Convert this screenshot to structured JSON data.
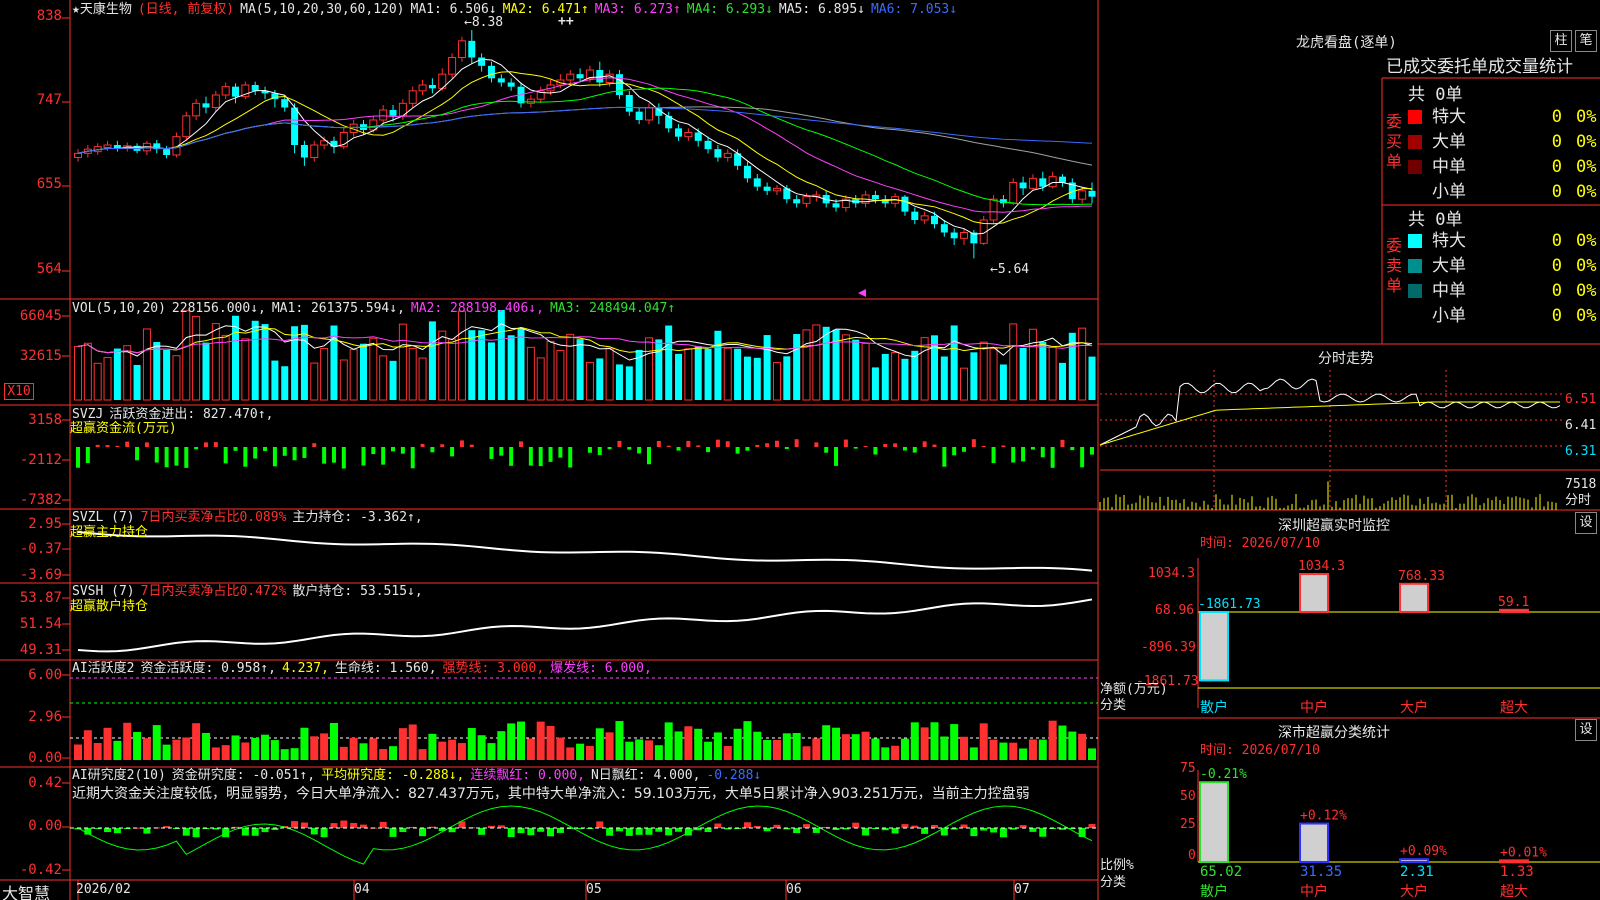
{
  "header": {
    "title": "★天康生物",
    "mode": "(日线, 前复权)",
    "ma_params": "MA(5,10,20,30,60,120)",
    "ma1": "MA1: 6.506↓",
    "ma2": "MA2: 6.471↑",
    "ma3": "MA3: 6.273↑",
    "ma4": "MA4: 6.293↓",
    "ma5": "MA5: 6.895↓",
    "ma6": "MA6: 7.053↓"
  },
  "price_axis": [
    "838",
    "747",
    "655",
    "564"
  ],
  "annotations": {
    "high": "8.38",
    "low": "5.64",
    "marker": "++"
  },
  "vol_header": {
    "label": "VOL(5,10,20)",
    "v": "228156.000↓,",
    "ma1": "MA1: 261375.594↓,",
    "ma2": "MA2: 288198.406↓,",
    "ma3": "MA3: 248494.047↑"
  },
  "vol_axis": [
    "66045",
    "32615",
    "X10"
  ],
  "svzj_header": {
    "name": "SVZJ",
    "text": "活跃资金进出: 827.470↑,",
    "sub": "超赢资金流(万元)"
  },
  "svzj_axis": [
    "3158",
    "-2112",
    "-7382"
  ],
  "svzl_header": {
    "name": "SVZL (7)",
    "text1": "7日内买卖净占比0.089%",
    "text2": "主力持仓: -3.362↑,",
    "sub": "超赢主力持仓"
  },
  "svzl_axis": [
    "2.95",
    "-0.37",
    "-3.69"
  ],
  "svsh_header": {
    "name": "SVSH (7)",
    "text1": "7日内买卖净占比0.472%",
    "text2": "散户持仓: 53.515↓,",
    "sub": "超赢散户持仓"
  },
  "svsh_axis": [
    "53.87",
    "51.54",
    "49.31"
  ],
  "ai1_header": {
    "name": "AI活跃度2",
    "t1": "资金活跃度: 0.958↑,",
    "t2": "4.237,",
    "t3": "生命线: 1.560,",
    "t4": "强势线: 3.000,",
    "t5": "爆发线: 6.000,"
  },
  "ai1_axis": [
    "6.00",
    "2.96",
    "0.00"
  ],
  "ai2_header": {
    "name": "AI研究度2(10)",
    "t1": "资金研究度: -0.051↑,",
    "t2": "平均研究度: -0.288↓,",
    "t3": "连续飘红: 0.000,",
    "t4": "N日飘红: 4.000,",
    "t5": "-0.288↓"
  },
  "ai2_text": "近期大资金关注度较低，明显弱势，今日大单净流入：827.437万元，其中特大单净流入：59.103万元，大单5日累计净入903.251万元，当前主力控盘弱",
  "ai2_axis": [
    "0.42",
    "0.00",
    "-0.42"
  ],
  "date_axis": [
    "2026/02",
    "04",
    "05",
    "06",
    "07"
  ],
  "logo": "大智慧",
  "right_panel": {
    "title": "龙虎看盘(逐单)",
    "btn1": "柱",
    "btn2": "笔",
    "table_head": "已成交委托单成交量统计",
    "buy_label": "委买单",
    "sell_label": "委卖单",
    "buy_total": "共 0单",
    "sell_total": "共 0单",
    "buy_rows": [
      {
        "label": "特大",
        "count": "0",
        "pct": "0%",
        "color": "#ff0000"
      },
      {
        "label": "大单",
        "count": "0",
        "pct": "0%",
        "color": "#a00000"
      },
      {
        "label": "中单",
        "count": "0",
        "pct": "0%",
        "color": "#700000"
      },
      {
        "label": "小单",
        "count": "0",
        "pct": "0%",
        "color": "#000000"
      }
    ],
    "sell_rows": [
      {
        "label": "特大",
        "count": "0",
        "pct": "0%",
        "color": "#00ffff"
      },
      {
        "label": "大单",
        "count": "0",
        "pct": "0%",
        "color": "#008f8f"
      },
      {
        "label": "中单",
        "count": "0",
        "pct": "0%",
        "color": "#006a6a"
      },
      {
        "label": "小单",
        "count": "0",
        "pct": "0%",
        "color": "#000000"
      }
    ],
    "intraday_title": "分时走势",
    "intraday_axis": [
      "6.51",
      "6.41",
      "6.31"
    ],
    "intraday_vol": [
      "7518",
      "分时"
    ],
    "sz_monitor_title": "深圳超赢实时监控",
    "sz_monitor_btn": "设",
    "sz_time": "时间: 2026/07/10",
    "sz_axis": [
      "1034.3",
      "68.96",
      "-896.39",
      "-1861.73"
    ],
    "sz_axis_label": [
      "净额(万元)",
      "分类"
    ],
    "sz_bars": [
      {
        "cat": "散户",
        "value": -1861.73,
        "label": "-1861.73"
      },
      {
        "cat": "中户",
        "value": 1034.3,
        "label": "1034.3"
      },
      {
        "cat": "大户",
        "value": 768.33,
        "label": "768.33"
      },
      {
        "cat": "超大",
        "value": 59.1,
        "label": "59.1"
      }
    ],
    "sz_class_title": "深市超赢分类统计",
    "sz_class_btn": "设",
    "sz_class_time": "时间: 2026/07/10",
    "sz_class_axis": [
      "75",
      "50",
      "25",
      "0"
    ],
    "sz_class_axis_label": [
      "比例%",
      "分类"
    ],
    "sz_class_bars": [
      {
        "cat": "散户",
        "value": 65.02,
        "label": "65.02",
        "chg": "-0.21%"
      },
      {
        "cat": "中户",
        "value": 31.35,
        "label": "31.35",
        "chg": "+0.12%"
      },
      {
        "cat": "大户",
        "value": 2.31,
        "label": "2.31",
        "chg": "+0.09%"
      },
      {
        "cat": "超大",
        "value": 1.33,
        "label": "1.33",
        "chg": "+0.01%"
      }
    ]
  },
  "chart_data": {
    "type": "candlestick",
    "price_range": [
      5.5,
      8.5
    ],
    "candles": [
      [
        6.85,
        6.9,
        6.8,
        6.95
      ],
      [
        6.9,
        6.95,
        6.85,
        7.0
      ],
      [
        6.92,
        6.98,
        6.88,
        7.02
      ],
      [
        6.97,
        7.0,
        6.93,
        7.05
      ],
      [
        7.0,
        6.96,
        6.92,
        7.05
      ],
      [
        6.96,
        6.99,
        6.92,
        7.03
      ],
      [
        6.99,
        6.93,
        6.9,
        7.02
      ],
      [
        6.93,
        7.02,
        6.88,
        7.05
      ],
      [
        7.02,
        6.95,
        6.9,
        7.06
      ],
      [
        6.95,
        6.88,
        6.84,
        6.99
      ],
      [
        6.88,
        7.1,
        6.85,
        7.15
      ],
      [
        7.1,
        7.35,
        7.05,
        7.4
      ],
      [
        7.35,
        7.5,
        7.3,
        7.55
      ],
      [
        7.5,
        7.45,
        7.38,
        7.58
      ],
      [
        7.45,
        7.6,
        7.4,
        7.65
      ],
      [
        7.6,
        7.7,
        7.55,
        7.75
      ],
      [
        7.7,
        7.58,
        7.5,
        7.74
      ],
      [
        7.58,
        7.72,
        7.55,
        7.76
      ],
      [
        7.72,
        7.65,
        7.6,
        7.76
      ],
      [
        7.65,
        7.62,
        7.55,
        7.7
      ],
      [
        7.62,
        7.55,
        7.45,
        7.66
      ],
      [
        7.55,
        7.45,
        7.4,
        7.6
      ],
      [
        7.45,
        7.0,
        6.9,
        7.5
      ],
      [
        7.0,
        6.85,
        6.75,
        7.05
      ],
      [
        6.85,
        7.0,
        6.8,
        7.05
      ],
      [
        7.0,
        7.05,
        6.95,
        7.1
      ],
      [
        7.05,
        6.98,
        6.9,
        7.1
      ],
      [
        6.98,
        7.15,
        6.95,
        7.2
      ],
      [
        7.15,
        7.25,
        7.1,
        7.3
      ],
      [
        7.25,
        7.18,
        7.12,
        7.3
      ],
      [
        7.18,
        7.3,
        7.15,
        7.35
      ],
      [
        7.3,
        7.42,
        7.25,
        7.48
      ],
      [
        7.42,
        7.35,
        7.28,
        7.48
      ],
      [
        7.35,
        7.5,
        7.3,
        7.55
      ],
      [
        7.5,
        7.65,
        7.45,
        7.7
      ],
      [
        7.65,
        7.72,
        7.6,
        7.78
      ],
      [
        7.72,
        7.68,
        7.62,
        7.8
      ],
      [
        7.68,
        7.85,
        7.65,
        7.92
      ],
      [
        7.85,
        8.05,
        7.8,
        8.1
      ],
      [
        8.05,
        8.25,
        8.0,
        8.3
      ],
      [
        8.25,
        8.05,
        7.98,
        8.38
      ],
      [
        8.05,
        7.95,
        7.88,
        8.1
      ],
      [
        7.95,
        7.8,
        7.75,
        8.0
      ],
      [
        7.8,
        7.75,
        7.7,
        7.85
      ],
      [
        7.75,
        7.7,
        7.65,
        7.8
      ],
      [
        7.7,
        7.5,
        7.45,
        7.75
      ],
      [
        7.5,
        7.55,
        7.45,
        7.6
      ],
      [
        7.55,
        7.65,
        7.5,
        7.7
      ],
      [
        7.65,
        7.72,
        7.6,
        7.78
      ],
      [
        7.72,
        7.78,
        7.68,
        7.85
      ],
      [
        7.78,
        7.85,
        7.72,
        7.9
      ],
      [
        7.85,
        7.8,
        7.75,
        7.92
      ],
      [
        7.8,
        7.9,
        7.75,
        7.95
      ],
      [
        7.9,
        7.75,
        7.7,
        8.0
      ],
      [
        7.75,
        7.85,
        7.7,
        7.9
      ],
      [
        7.85,
        7.6,
        7.55,
        7.9
      ],
      [
        7.6,
        7.4,
        7.35,
        7.65
      ],
      [
        7.4,
        7.3,
        7.25,
        7.45
      ],
      [
        7.3,
        7.45,
        7.25,
        7.5
      ],
      [
        7.45,
        7.35,
        7.25,
        7.5
      ],
      [
        7.35,
        7.2,
        7.15,
        7.4
      ],
      [
        7.2,
        7.1,
        7.05,
        7.25
      ],
      [
        7.1,
        7.15,
        7.05,
        7.2
      ],
      [
        7.15,
        7.05,
        6.98,
        7.2
      ],
      [
        7.05,
        6.95,
        6.9,
        7.1
      ],
      [
        6.95,
        6.85,
        6.8,
        7.0
      ],
      [
        6.85,
        6.9,
        6.8,
        6.95
      ],
      [
        6.9,
        6.75,
        6.7,
        6.95
      ],
      [
        6.75,
        6.6,
        6.55,
        6.8
      ],
      [
        6.6,
        6.5,
        6.45,
        6.65
      ],
      [
        6.5,
        6.45,
        6.4,
        6.55
      ],
      [
        6.45,
        6.48,
        6.4,
        6.52
      ],
      [
        6.48,
        6.35,
        6.3,
        6.52
      ],
      [
        6.35,
        6.3,
        6.25,
        6.4
      ],
      [
        6.3,
        6.38,
        6.25,
        6.42
      ],
      [
        6.38,
        6.4,
        6.32,
        6.45
      ],
      [
        6.4,
        6.3,
        6.25,
        6.45
      ],
      [
        6.3,
        6.25,
        6.2,
        6.35
      ],
      [
        6.25,
        6.35,
        6.2,
        6.4
      ],
      [
        6.35,
        6.3,
        6.25,
        6.4
      ],
      [
        6.3,
        6.4,
        6.25,
        6.45
      ],
      [
        6.4,
        6.35,
        6.3,
        6.45
      ],
      [
        6.35,
        6.3,
        6.25,
        6.4
      ],
      [
        6.3,
        6.38,
        6.25,
        6.42
      ],
      [
        6.38,
        6.2,
        6.15,
        6.4
      ],
      [
        6.2,
        6.1,
        6.05,
        6.25
      ],
      [
        6.1,
        6.15,
        6.05,
        6.2
      ],
      [
        6.15,
        6.05,
        6.0,
        6.2
      ],
      [
        6.05,
        5.95,
        5.9,
        6.1
      ],
      [
        5.95,
        5.88,
        5.8,
        6.0
      ],
      [
        5.88,
        5.95,
        5.8,
        6.0
      ],
      [
        5.95,
        5.82,
        5.64,
        5.98
      ],
      [
        5.82,
        6.1,
        5.8,
        6.15
      ],
      [
        6.1,
        6.35,
        6.05,
        6.4
      ],
      [
        6.35,
        6.3,
        6.25,
        6.4
      ],
      [
        6.3,
        6.55,
        6.28,
        6.6
      ],
      [
        6.55,
        6.48,
        6.4,
        6.62
      ],
      [
        6.48,
        6.6,
        6.45,
        6.65
      ],
      [
        6.6,
        6.5,
        6.45,
        6.68
      ],
      [
        6.5,
        6.62,
        6.48,
        6.68
      ],
      [
        6.62,
        6.55,
        6.5,
        6.65
      ],
      [
        6.55,
        6.35,
        6.3,
        6.6
      ],
      [
        6.35,
        6.45,
        6.3,
        6.5
      ],
      [
        6.45,
        6.38,
        6.3,
        6.55
      ]
    ]
  }
}
